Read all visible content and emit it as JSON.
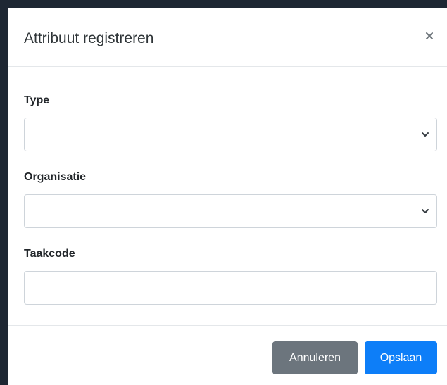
{
  "dialog": {
    "title": "Attribuut registreren",
    "close_icon": "close-icon"
  },
  "form": {
    "type": {
      "label": "Type",
      "value": ""
    },
    "organisatie": {
      "label": "Organisatie",
      "value": ""
    },
    "taakcode": {
      "label": "Taakcode",
      "value": ""
    }
  },
  "footer": {
    "cancel_label": "Annuleren",
    "save_label": "Opslaan"
  },
  "colors": {
    "cancel_button": "#6c757d",
    "save_button": "#0d7ef8",
    "backdrop": "#1e2733"
  }
}
